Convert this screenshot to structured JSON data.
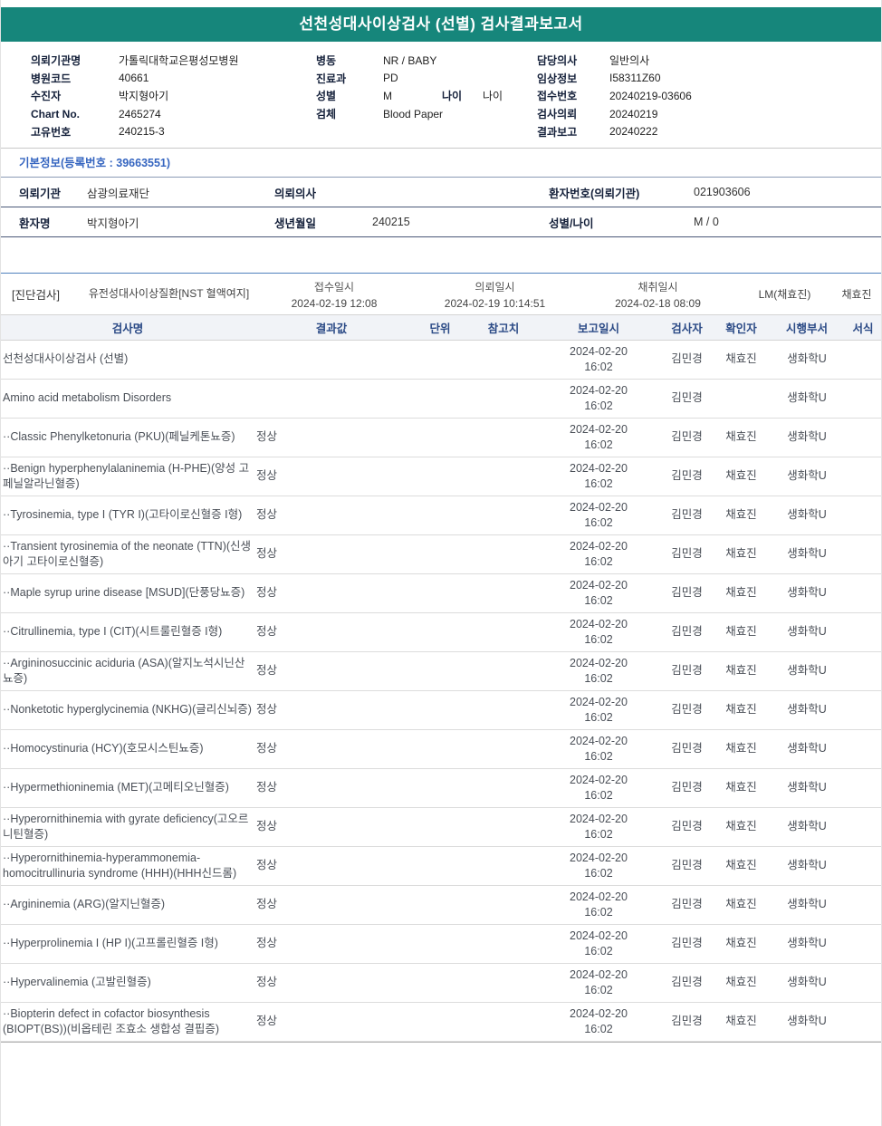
{
  "title": "선천성대사이상검사 (선별) 검사결과보고서",
  "patient_header": {
    "col1": [
      {
        "label": "의뢰기관명",
        "value": "가톨릭대학교은평성모병원"
      },
      {
        "label": "병원코드",
        "value": "40661"
      },
      {
        "label": "수진자",
        "value": "박지형아기"
      },
      {
        "label": "Chart No.",
        "value": "2465274"
      },
      {
        "label": "고유번호",
        "value": "240215-3"
      }
    ],
    "col2": [
      {
        "label": "병동",
        "value": "NR / BABY"
      },
      {
        "label": "진료과",
        "value": "PD"
      },
      {
        "label": "성별",
        "value": "M",
        "label2": "나이",
        "value2": "나이"
      },
      {
        "label": "검체",
        "value": "Blood Paper"
      }
    ],
    "col3": [
      {
        "label": "담당의사",
        "value": "일반의사"
      },
      {
        "label": "임상정보",
        "value": "I58311Z60"
      },
      {
        "label": "접수번호",
        "value": "20240219-03606"
      },
      {
        "label": "검사의뢰",
        "value": "20240219"
      },
      {
        "label": "결과보고",
        "value": "20240222"
      }
    ]
  },
  "basic_info": {
    "section_title": "기본정보(등록번호 : 39663551)",
    "rows": [
      {
        "c1_label": "의뢰기관",
        "c1_value": "삼광의료재단",
        "c2_label": "의뢰의사",
        "c2_value": "",
        "c3_label": "환자번호(의뢰기관)",
        "c3_value": "021903606"
      },
      {
        "c1_label": "환자명",
        "c1_value": "박지형아기",
        "c2_label": "생년월일",
        "c2_value": "240215",
        "c3_label": "성별/나이",
        "c3_value": "M / 0"
      }
    ]
  },
  "diagnosis": {
    "tag": "[진단검사]",
    "test_name": "유전성대사이상질환[NST 혈액여지]",
    "received_label": "접수일시",
    "received_value": "2024-02-19 12:08",
    "requested_label": "의뢰일시",
    "requested_value": "2024-02-19 10:14:51",
    "collected_label": "채취일시",
    "collected_value": "2024-02-18 08:09",
    "collector": "LM(채효진)",
    "collector_name": "채효진"
  },
  "results": {
    "headers": [
      "검사명",
      "결과값",
      "단위",
      "참고치",
      "보고일시",
      "검사자",
      "확인자",
      "시행부서",
      "서식"
    ],
    "rows": [
      {
        "name": "선천성대사이상검사 (선별)",
        "indent": 0,
        "result": "",
        "unit": "",
        "ref": "",
        "date": "2024-02-20 16:02",
        "tester": "김민경",
        "confirmer": "채효진",
        "dept": "생화학U",
        "form": ""
      },
      {
        "name": "Amino acid metabolism Disorders",
        "indent": 1,
        "result": "",
        "unit": "",
        "ref": "",
        "date": "2024-02-20 16:02",
        "tester": "김민경",
        "confirmer": "",
        "dept": "생화학U",
        "form": ""
      },
      {
        "name": "··Classic Phenylketonuria (PKU)(페닐케톤뇨증)",
        "indent": 2,
        "result": "정상",
        "unit": "",
        "ref": "",
        "date": "2024-02-20 16:02",
        "tester": "김민경",
        "confirmer": "채효진",
        "dept": "생화학U",
        "form": ""
      },
      {
        "name": "··Benign hyperphenylalaninemia (H-PHE)(양성 고페닐알라닌혈증)",
        "indent": 2,
        "result": "정상",
        "unit": "",
        "ref": "",
        "date": "2024-02-20 16:02",
        "tester": "김민경",
        "confirmer": "채효진",
        "dept": "생화학U",
        "form": ""
      },
      {
        "name": "··Tyrosinemia, type I (TYR I)(고타이로신혈증 I형)",
        "indent": 2,
        "result": "정상",
        "unit": "",
        "ref": "",
        "date": "2024-02-20 16:02",
        "tester": "김민경",
        "confirmer": "채효진",
        "dept": "생화학U",
        "form": ""
      },
      {
        "name": "··Transient tyrosinemia of the neonate (TTN)(신생아기 고타이로신혈증)",
        "indent": 2,
        "result": "정상",
        "unit": "",
        "ref": "",
        "date": "2024-02-20 16:02",
        "tester": "김민경",
        "confirmer": "채효진",
        "dept": "생화학U",
        "form": ""
      },
      {
        "name": "··Maple syrup urine disease [MSUD](단풍당뇨증)",
        "indent": 2,
        "result": "정상",
        "unit": "",
        "ref": "",
        "date": "2024-02-20 16:02",
        "tester": "김민경",
        "confirmer": "채효진",
        "dept": "생화학U",
        "form": ""
      },
      {
        "name": "··Citrullinemia, type I (CIT)(시트룰린혈증 I형)",
        "indent": 2,
        "result": "정상",
        "unit": "",
        "ref": "",
        "date": "2024-02-20 16:02",
        "tester": "김민경",
        "confirmer": "채효진",
        "dept": "생화학U",
        "form": ""
      },
      {
        "name": "··Argininosuccinic aciduria (ASA)(알지노석시닌산뇨증)",
        "indent": 2,
        "result": "정상",
        "unit": "",
        "ref": "",
        "date": "2024-02-20 16:02",
        "tester": "김민경",
        "confirmer": "채효진",
        "dept": "생화학U",
        "form": ""
      },
      {
        "name": "··Nonketotic hyperglycinemia (NKHG)(글리신뇌증)",
        "indent": 2,
        "result": "정상",
        "unit": "",
        "ref": "",
        "date": "2024-02-20 16:02",
        "tester": "김민경",
        "confirmer": "채효진",
        "dept": "생화학U",
        "form": ""
      },
      {
        "name": "··Homocystinuria (HCY)(호모시스틴뇨증)",
        "indent": 2,
        "result": "정상",
        "unit": "",
        "ref": "",
        "date": "2024-02-20 16:02",
        "tester": "김민경",
        "confirmer": "채효진",
        "dept": "생화학U",
        "form": ""
      },
      {
        "name": "··Hypermethioninemia (MET)(고메티오닌혈증)",
        "indent": 2,
        "result": "정상",
        "unit": "",
        "ref": "",
        "date": "2024-02-20 16:02",
        "tester": "김민경",
        "confirmer": "채효진",
        "dept": "생화학U",
        "form": ""
      },
      {
        "name": "··Hyperornithinemia with gyrate deficiency(고오르니틴혈증)",
        "indent": 2,
        "result": "정상",
        "unit": "",
        "ref": "",
        "date": "2024-02-20 16:02",
        "tester": "김민경",
        "confirmer": "채효진",
        "dept": "생화학U",
        "form": ""
      },
      {
        "name": "··Hyperornithinemia-hyperammonemia-homocitrullinuria syndrome (HHH)(HHH신드롬)",
        "indent": 2,
        "result": "정상",
        "unit": "",
        "ref": "",
        "date": "2024-02-20 16:02",
        "tester": "김민경",
        "confirmer": "채효진",
        "dept": "생화학U",
        "form": ""
      },
      {
        "name": "··Argininemia (ARG)(알지닌혈증)",
        "indent": 2,
        "result": "정상",
        "unit": "",
        "ref": "",
        "date": "2024-02-20 16:02",
        "tester": "김민경",
        "confirmer": "채효진",
        "dept": "생화학U",
        "form": ""
      },
      {
        "name": "··Hyperprolinemia I (HP I)(고프롤린혈증 I형)",
        "indent": 2,
        "result": "정상",
        "unit": "",
        "ref": "",
        "date": "2024-02-20 16:02",
        "tester": "김민경",
        "confirmer": "채효진",
        "dept": "생화학U",
        "form": ""
      },
      {
        "name": "··Hypervalinemia (고발린혈증)",
        "indent": 2,
        "result": "정상",
        "unit": "",
        "ref": "",
        "date": "2024-02-20 16:02",
        "tester": "김민경",
        "confirmer": "채효진",
        "dept": "생화학U",
        "form": ""
      },
      {
        "name": "··Biopterin defect in cofactor biosynthesis (BIOPT(BS))(비옵테린 조효소 생합성 결핍증)",
        "indent": 2,
        "result": "정상",
        "unit": "",
        "ref": "",
        "date": "2024-02-20 16:02",
        "tester": "김민경",
        "confirmer": "채효진",
        "dept": "생화학U",
        "form": ""
      }
    ]
  }
}
